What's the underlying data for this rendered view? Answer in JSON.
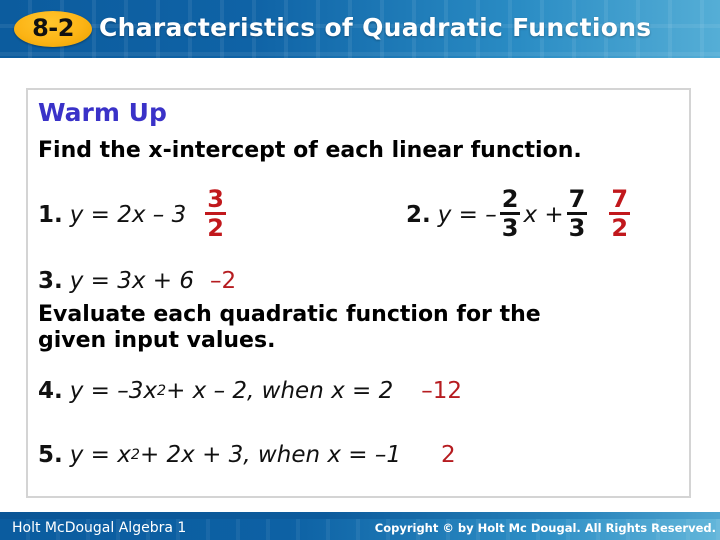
{
  "header": {
    "badge": "8-2",
    "title": "Characteristics of Quadratic Functions"
  },
  "panel": {
    "warmup_title": "Warm Up",
    "instruction_1": "Find the x-intercept of each linear function.",
    "instruction_2_line1": "Evaluate each quadratic function for the",
    "instruction_2_line2": "given input values.",
    "problems": [
      {
        "number": "1.",
        "expression": "y = 2x – 3",
        "answer_numerator": "3",
        "answer_denominator": "2"
      },
      {
        "number": "2.",
        "expression_prefix": "y = –",
        "coef_numerator": "2",
        "coef_denominator": "3",
        "expression_mid": "x +",
        "const_numerator": "7",
        "const_denominator": "3",
        "answer_numerator": "7",
        "answer_denominator": "2"
      },
      {
        "number": "3.",
        "expression": "y = 3x + 6",
        "answer": "–2"
      },
      {
        "number": "4.",
        "expression_before_exp": "y = –3x",
        "exponent": "2",
        "expression_after_exp": " + x – 2, when x = 2",
        "answer": "–12"
      },
      {
        "number": "5.",
        "expression_before_exp": "y = x",
        "exponent": "2",
        "expression_after_exp": " + 2x + 3, when x = –1",
        "answer": "2"
      }
    ]
  },
  "footer": {
    "left_text": "Holt McDougal Algebra 1",
    "right_text": "Copyright © by Holt Mc Dougal. All Rights Reserved."
  },
  "colors": {
    "header_blue_dark": "#0c5c9e",
    "header_blue_light": "#55aed6",
    "badge_gold": "#fcb415",
    "warmup_purple": "#3a32c8",
    "answer_red": "#b61c20",
    "panel_border": "#d4d4d4"
  }
}
